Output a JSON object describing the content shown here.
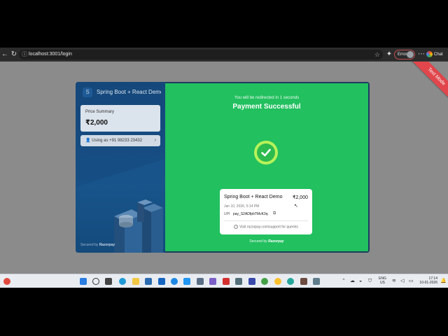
{
  "browser": {
    "url": "localhost:3001/login",
    "error_label": "Error",
    "chat_label": "Chat"
  },
  "test_mode": "Test Mode",
  "left_panel": {
    "merchant_initial": "S",
    "merchant_name": "Spring Boot + React Demo",
    "price_summary_label": "Price Summary",
    "price_value": "₹2,000",
    "using_as": "Using as +91 98233 23432",
    "secured_by": "Secured by",
    "brand": "Razorpay"
  },
  "right_panel": {
    "redirect_text": "You will be redirected in 1 seconds",
    "title": "Payment Successful",
    "receipt": {
      "name": "Spring Boot + React Demo",
      "amount": "₹2,000",
      "date": "Jan 10, 2026, 5:14 PM",
      "upi_label": "UPI",
      "upi_id": "pay_S2ADfpbTMvK3q",
      "support_text": "Visit razorpay.com/support for queries"
    },
    "secured_by": "Secured by",
    "brand": "Razorpay"
  },
  "taskbar": {
    "lang_line1": "ENG",
    "lang_line2": "US",
    "time": "17:14",
    "date": "10-01-2026"
  },
  "colors": {
    "success_green": "#22c05f",
    "razorpay_blue": "#15477a",
    "test_ribbon": "#e0464b"
  }
}
